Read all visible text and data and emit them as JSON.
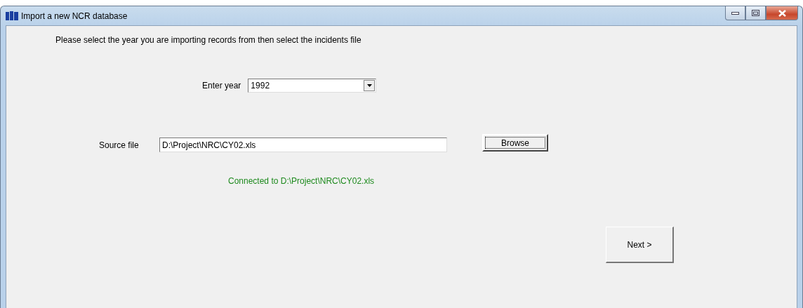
{
  "window": {
    "title": "Import a new NCR database"
  },
  "instruction": "Please select the year you are importing records from then select the incidents file",
  "year": {
    "label": "Enter year",
    "value": "1992"
  },
  "source": {
    "label": "Source file",
    "value": "D:\\Project\\NRC\\CY02.xls"
  },
  "browse_button": "Browse",
  "status": "Connected to D:\\Project\\NRC\\CY02.xls",
  "next_button": "Next >"
}
